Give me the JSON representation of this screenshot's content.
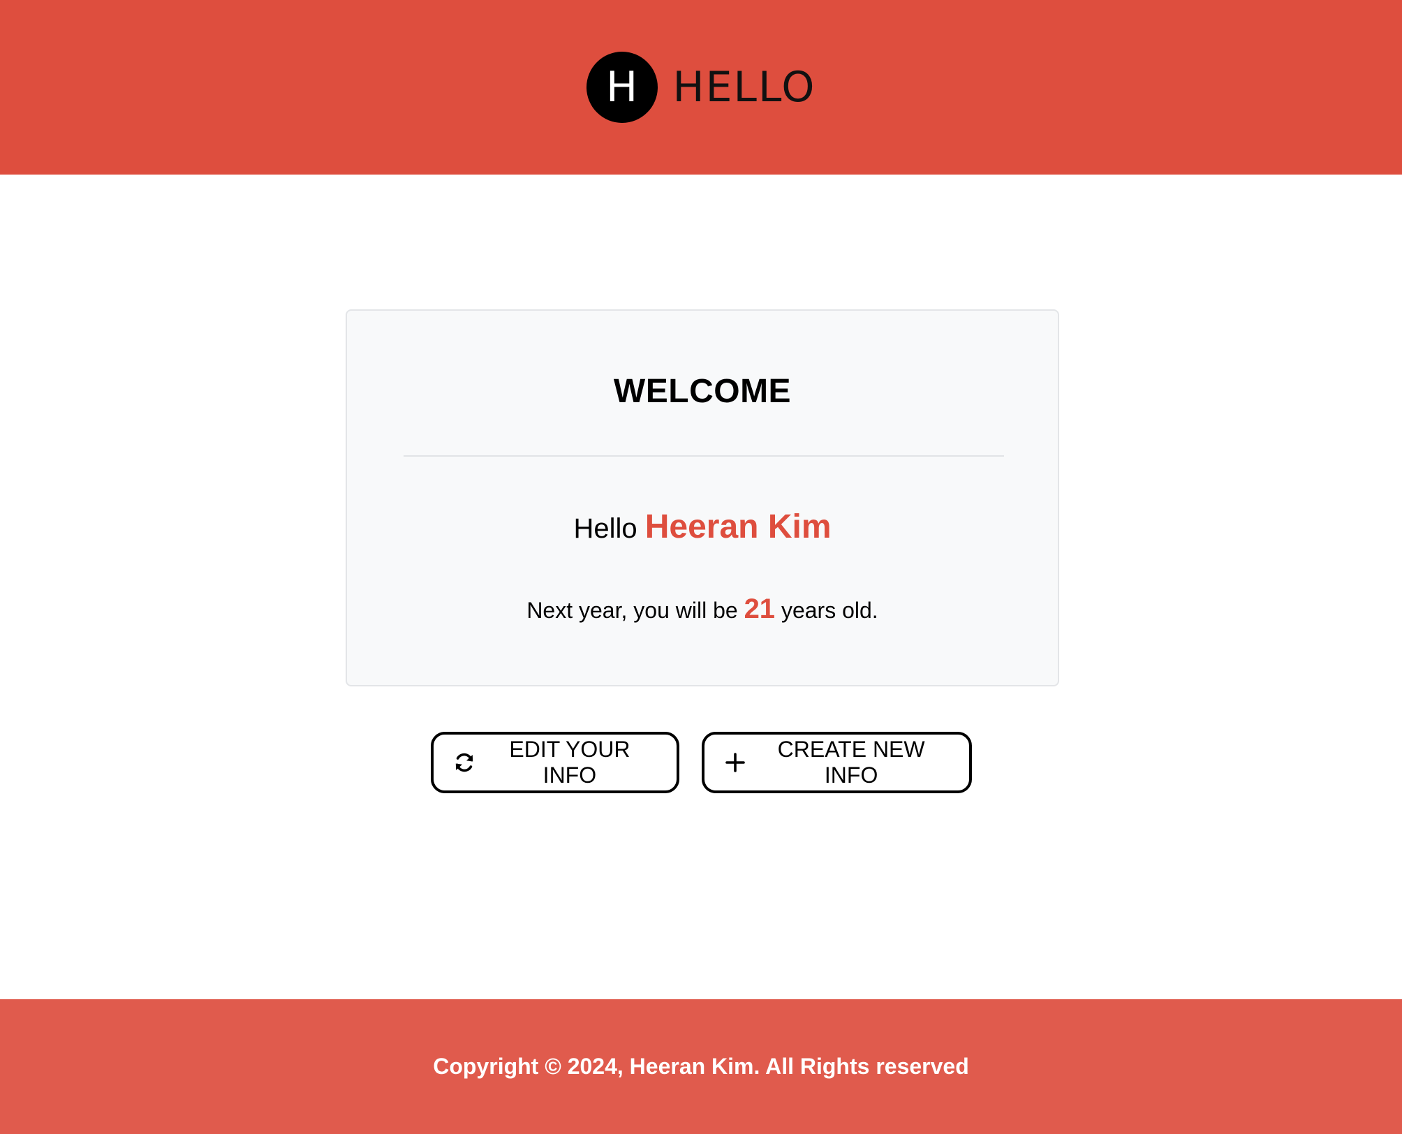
{
  "header": {
    "logo_letter": "H",
    "brand_text": "HELLO",
    "background_color": "#de4e3e"
  },
  "card": {
    "title": "WELCOME",
    "greeting_prefix": "Hello",
    "user_name": "Heeran Kim",
    "age_prefix": "Next year, you will be",
    "age_value": "21",
    "age_suffix": "years old.",
    "accent_color": "#de4e3e"
  },
  "buttons": {
    "edit": {
      "label": "EDIT YOUR INFO",
      "icon": "refresh-icon"
    },
    "create": {
      "label": "CREATE NEW INFO",
      "icon": "plus-icon"
    }
  },
  "footer": {
    "copyright": "Copyright © 2024, Heeran Kim. All Rights reserved",
    "background_color": "#e05b4d"
  }
}
